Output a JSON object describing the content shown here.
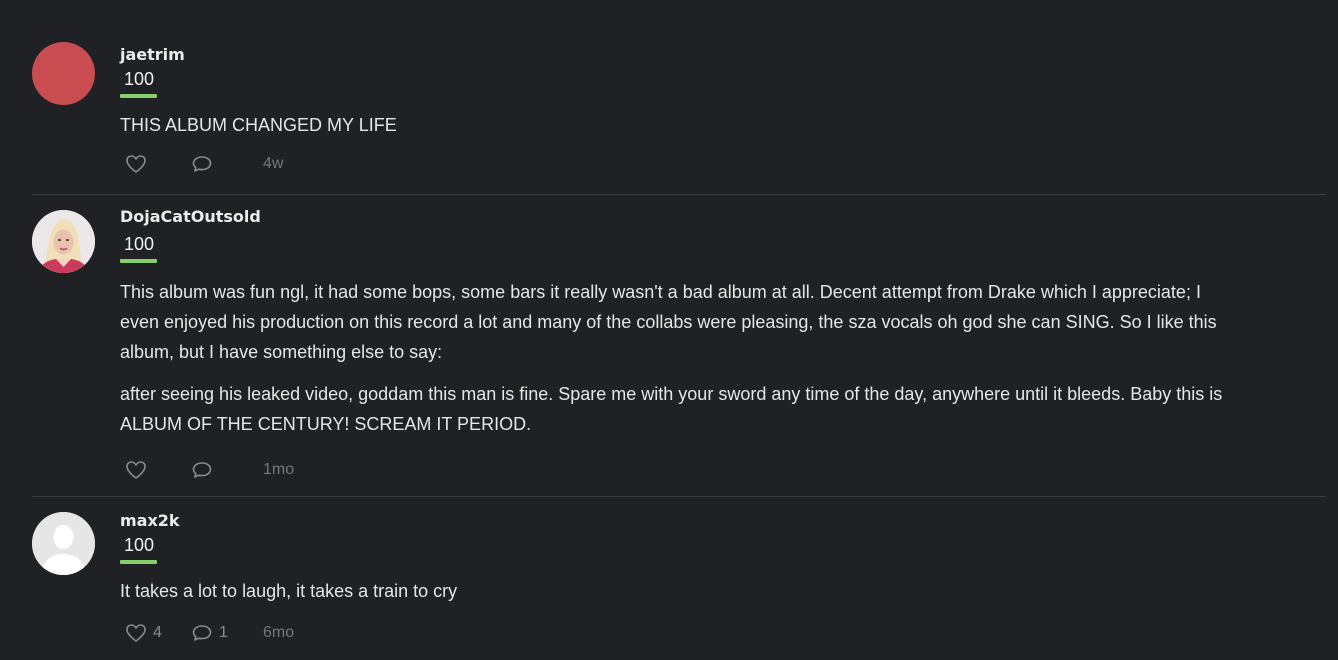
{
  "reviews": [
    {
      "username": "jaetrim",
      "score": "100",
      "paragraphs": [
        "THIS ALBUM CHANGED MY LIFE"
      ],
      "likes": "",
      "comments": "",
      "ago": "4w",
      "avatar": "solid-red-circle"
    },
    {
      "username": "DojaCatOutsold",
      "score": "100",
      "paragraphs": [
        "This album was fun ngl, it had some bops, some bars it really wasn't a bad album at all. Decent attempt from Drake which I appreciate; I even enjoyed his production on this record a lot and many of the collabs were pleasing, the sza vocals oh god she can SING. So I like this album, but I have something else to say:",
        "after seeing his leaked video, goddam this man is fine. Spare me with your sword any time of the day, anywhere until it bleeds. Baby this is ALBUM OF THE CENTURY! SCREAM IT PERIOD."
      ],
      "likes": "",
      "comments": "",
      "ago": "1mo",
      "avatar": "user-photo"
    },
    {
      "username": "max2k",
      "score": "100",
      "paragraphs": [
        "It takes a lot to laugh, it takes a train to cry"
      ],
      "likes": "4",
      "comments": "1",
      "ago": "6mo",
      "avatar": "default-user-silhouette"
    }
  ],
  "icons": {
    "like": "heart-icon",
    "comment": "speech-bubble-icon"
  },
  "colors": {
    "background": "#202124",
    "score_bar": "#86d06b",
    "avatar_red": "#c94c50",
    "divider": "#3a3b3e"
  }
}
